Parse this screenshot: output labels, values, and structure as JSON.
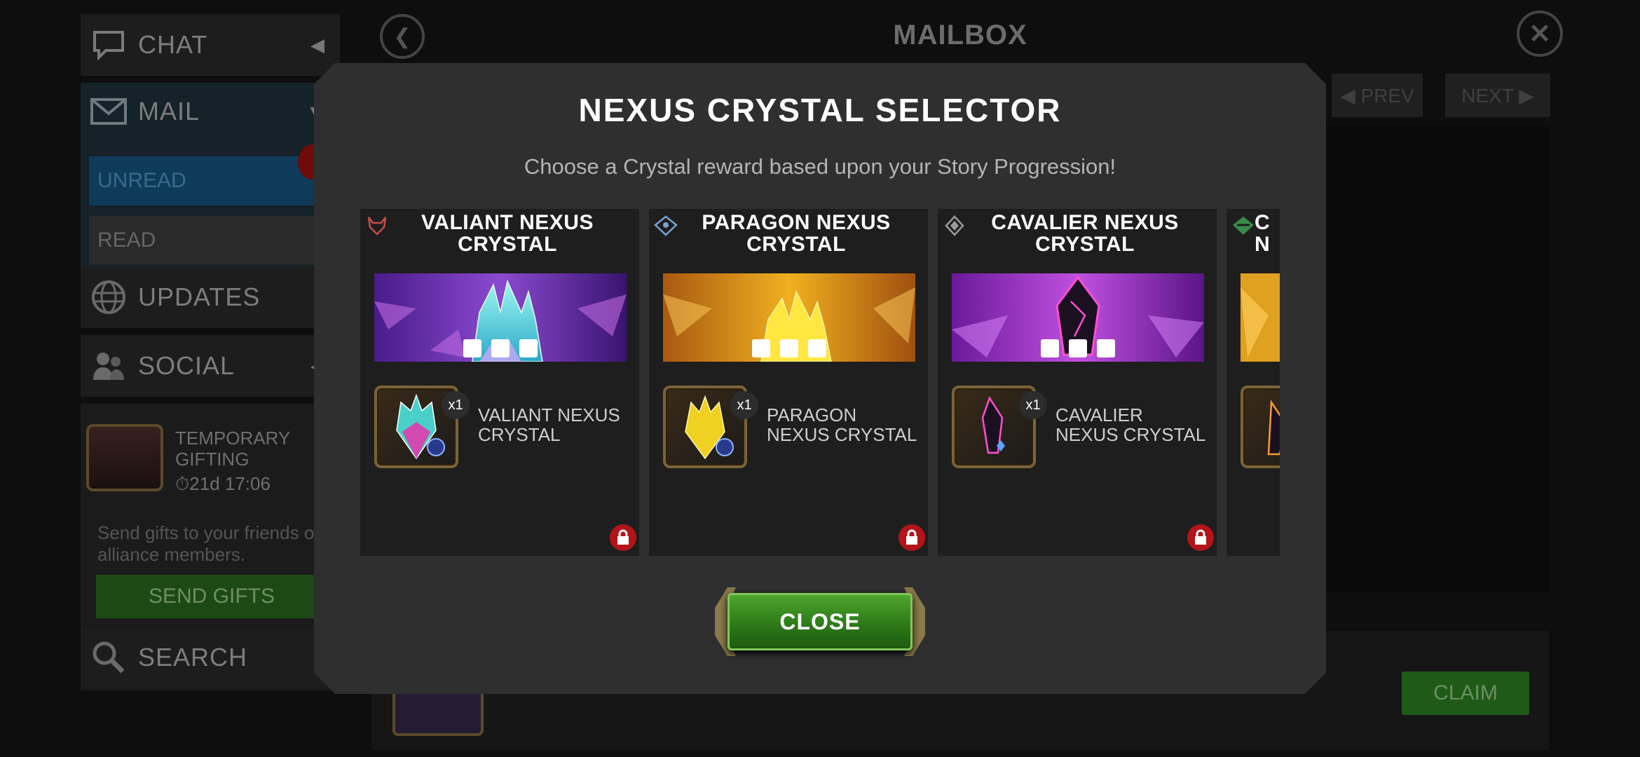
{
  "sidebar": {
    "chat_label": "CHAT",
    "mail_label": "MAIL",
    "unread_label": "UNREAD",
    "read_label": "READ",
    "updates_label": "UPDATES",
    "social_label": "SOCIAL",
    "gifting": {
      "title": "TEMPORARY GIFTING",
      "timer": "21d 17:06",
      "description": "Send gifts to your friends or alliance members.",
      "send_label": "SEND GIFTS"
    },
    "search_label": "SEARCH"
  },
  "mailbox": {
    "title": "MAILBOX",
    "prev_label": "◀ PREV",
    "next_label": "NEXT ▶",
    "claim_label": "CLAIM"
  },
  "modal": {
    "title": "NEXUS CRYSTAL SELECTOR",
    "subtitle": "Choose a Crystal reward based upon your Story Progression!",
    "close_label": "CLOSE",
    "cards": [
      {
        "title_line1": "VALIANT NEXUS",
        "title_line2": "CRYSTAL",
        "reward_name": "VALIANT NEXUS CRYSTAL",
        "quantity": "x1",
        "class_icon": "valiant-class-icon",
        "locked": true
      },
      {
        "title_line1": "PARAGON NEXUS",
        "title_line2": "CRYSTAL",
        "reward_name": "PARAGON NEXUS CRYSTAL",
        "quantity": "x1",
        "class_icon": "paragon-class-icon",
        "locked": true
      },
      {
        "title_line1": "CAVALIER NEXUS",
        "title_line2": "CRYSTAL",
        "reward_name": "CAVALIER NEXUS CRYSTAL",
        "quantity": "x1",
        "class_icon": "cavalier-class-icon",
        "locked": true
      },
      {
        "title_line1": "C",
        "title_line2": "N",
        "class_icon": "class-icon"
      }
    ]
  },
  "colors": {
    "modal_bg": "#2f2f2f",
    "close_button": "#3f8f22",
    "lock_badge": "#b3141a",
    "unread_tab": "#0f3b5a",
    "send_gifts": "#1d4a14",
    "claim": "#1f5a18"
  }
}
